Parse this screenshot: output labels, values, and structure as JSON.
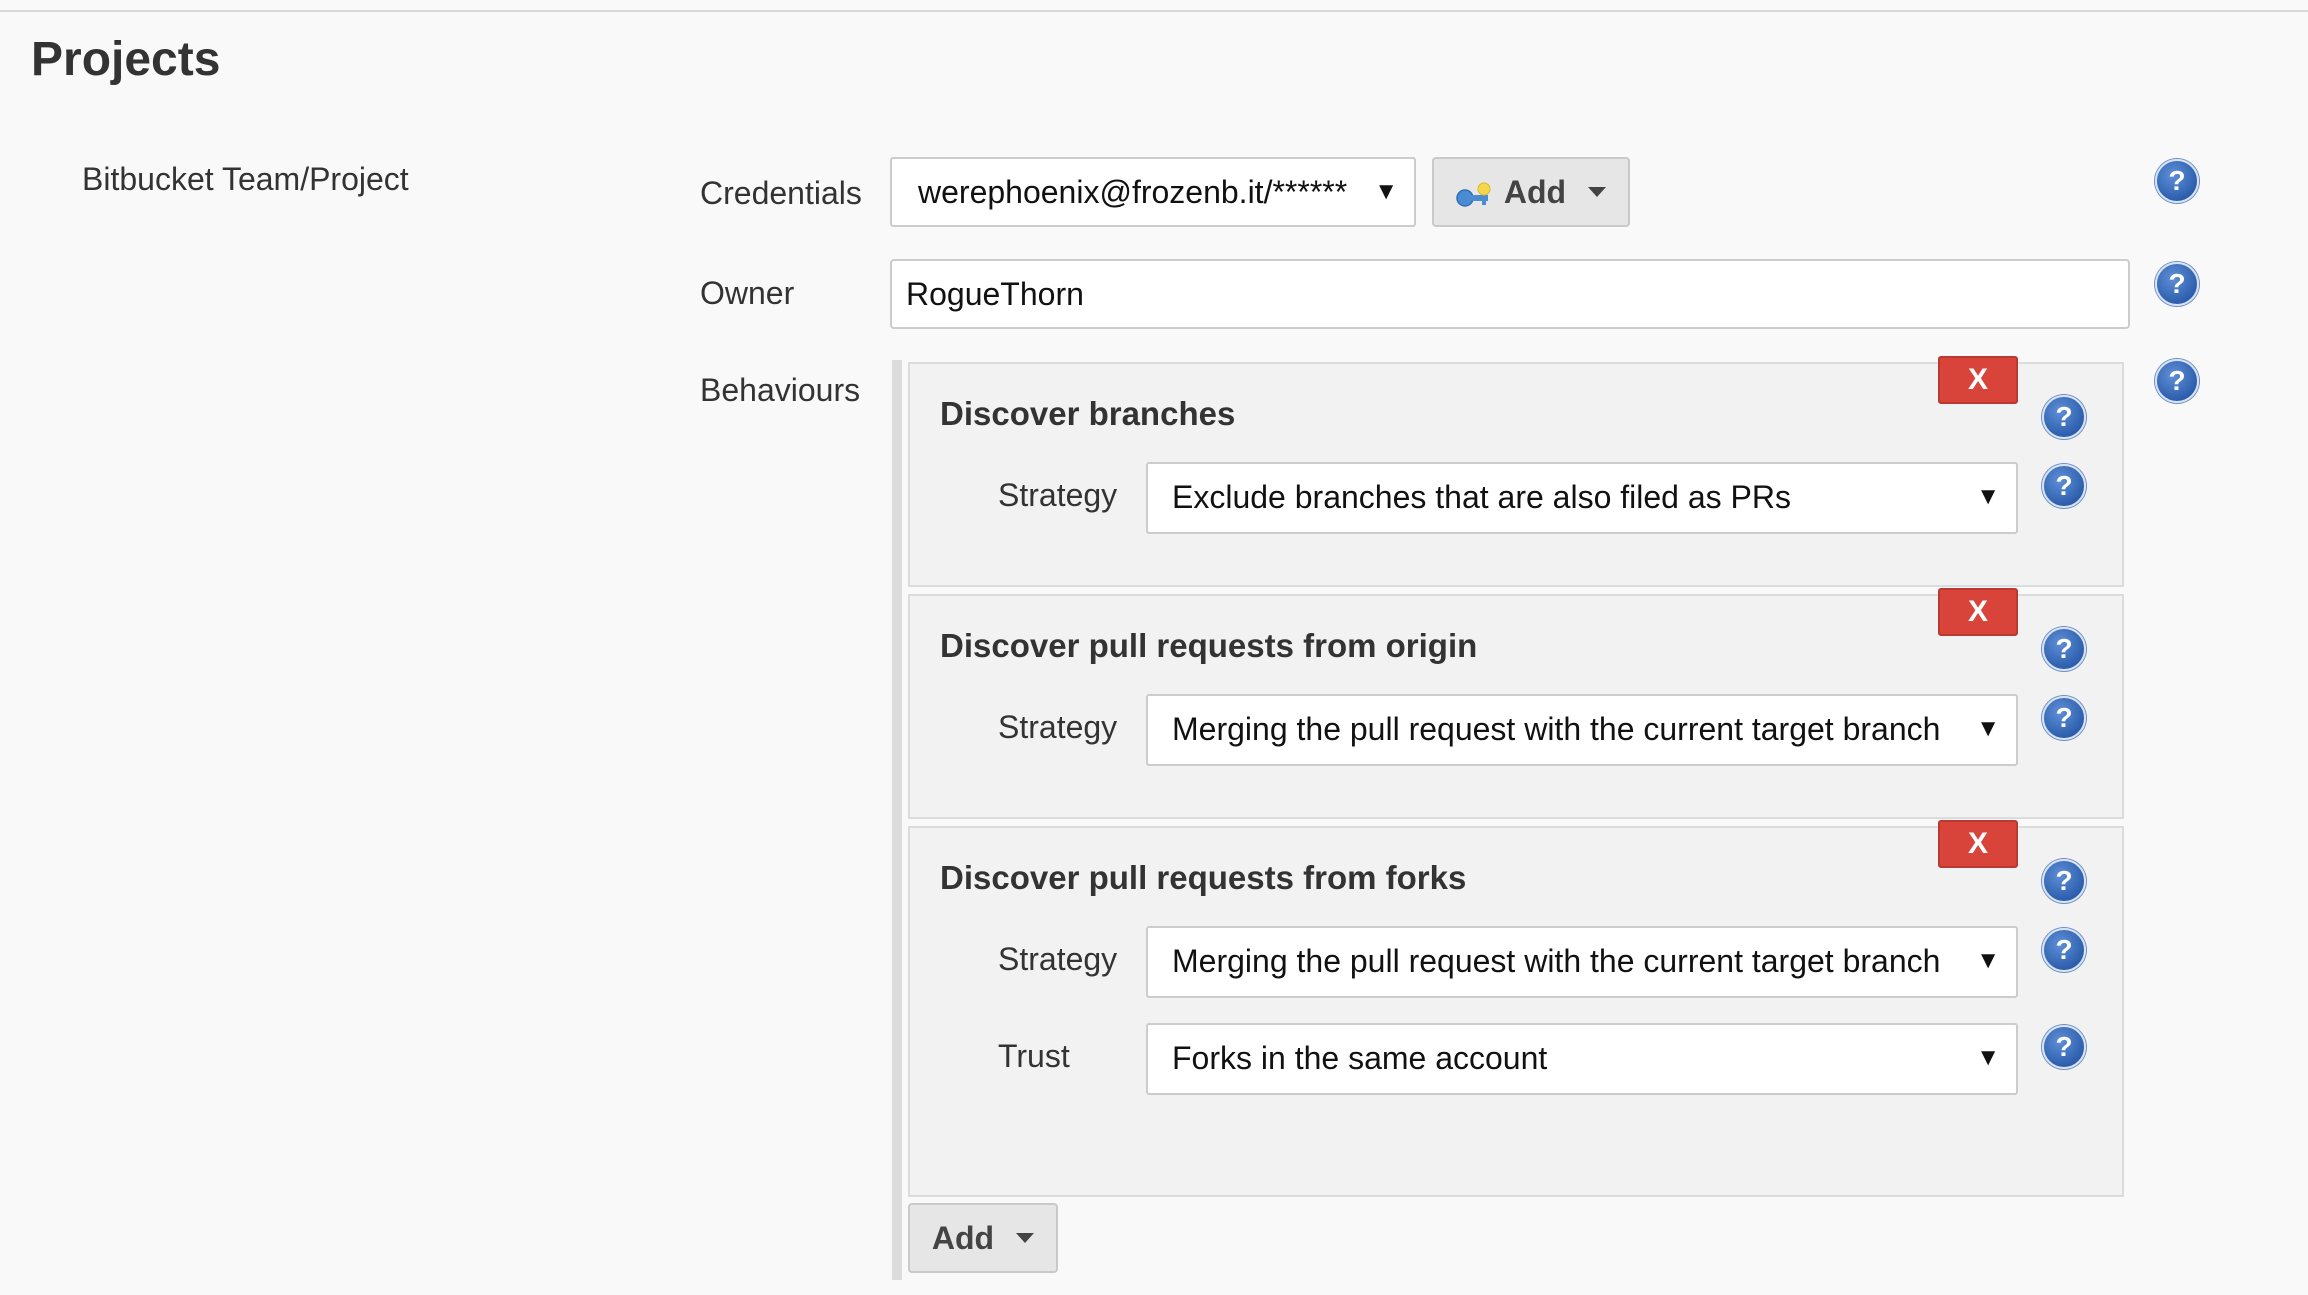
{
  "page": {
    "title": "Projects"
  },
  "section": {
    "label": "Bitbucket Team/Project"
  },
  "credentials": {
    "label": "Credentials",
    "value": "werephoenix@frozenb.it/******",
    "add_label": "Add"
  },
  "owner": {
    "label": "Owner",
    "value": "RogueThorn"
  },
  "behaviours": {
    "label": "Behaviours",
    "add_label": "Add",
    "items": [
      {
        "title": "Discover branches",
        "delete_label": "X",
        "fields": [
          {
            "label": "Strategy",
            "value": "Exclude branches that are also filed as PRs"
          }
        ]
      },
      {
        "title": "Discover pull requests from origin",
        "delete_label": "X",
        "fields": [
          {
            "label": "Strategy",
            "value": "Merging the pull request with the current target branch"
          }
        ]
      },
      {
        "title": "Discover pull requests from forks",
        "delete_label": "X",
        "fields": [
          {
            "label": "Strategy",
            "value": "Merging the pull request with the current target branch"
          },
          {
            "label": "Trust",
            "value": "Forks in the same account"
          }
        ]
      }
    ]
  },
  "help": {
    "glyph": "?"
  },
  "icons": {
    "help": "help-icon",
    "credentials": "key-icon",
    "caret": "caret-down-icon"
  },
  "colors": {
    "delete": "#d9443a",
    "help": "#2d5fae"
  }
}
